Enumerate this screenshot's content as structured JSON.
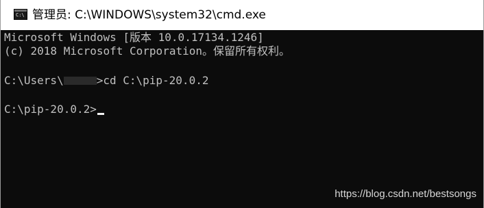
{
  "window": {
    "title": "管理员: C:\\WINDOWS\\system32\\cmd.exe",
    "icon": "cmd-console-icon",
    "icon_glyph": "C:\\",
    "background_color": "#0c0c0c",
    "text_color": "#c0c0c0"
  },
  "console": {
    "lines": [
      "Microsoft Windows [版本 10.0.17134.1246]",
      "(c) 2018 Microsoft Corporation。保留所有权利。",
      "",
      "",
      "",
      ""
    ],
    "command_prompt_prefix": "C:\\Users\\",
    "command_prompt_suffix": ">cd C:\\pip-20.0.2",
    "current_prompt": "C:\\pip-20.0.2>"
  },
  "watermark": "https://blog.csdn.net/bestsongs"
}
